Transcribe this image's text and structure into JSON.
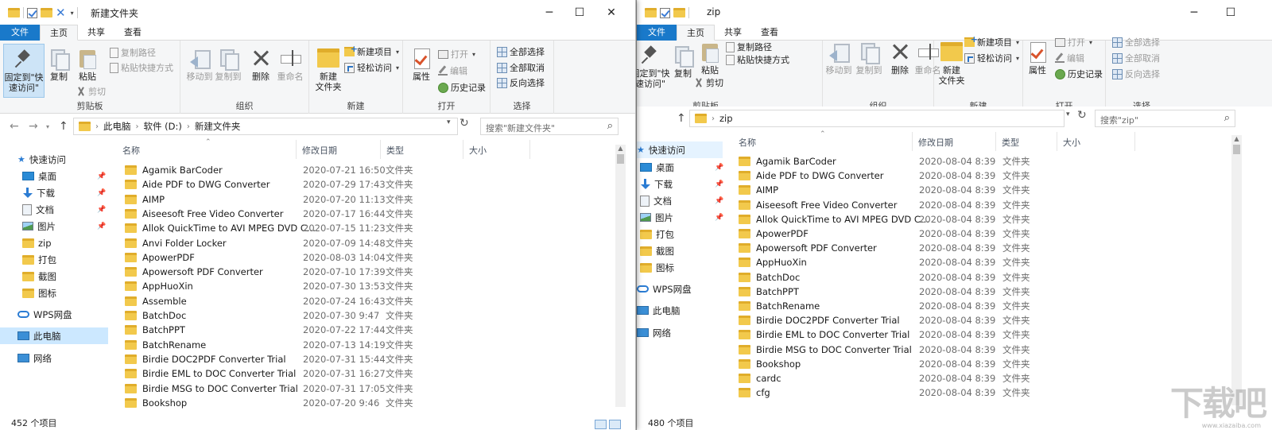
{
  "left": {
    "title": "新建文件夹",
    "tabs": [
      "文件",
      "主页",
      "共享",
      "查看"
    ],
    "ribbon": {
      "clipboard": {
        "pin_label": "固定到\"快速访问\"",
        "copy": "复制",
        "paste": "粘贴",
        "copy_path": "复制路径",
        "paste_shortcut": "粘贴快捷方式",
        "cut": "剪切",
        "group": "剪贴板"
      },
      "organize": {
        "move_to": "移动到",
        "copy_to": "复制到",
        "delete": "删除",
        "rename": "重命名",
        "group": "组织"
      },
      "new": {
        "new_folder": "新建\n文件夹",
        "new_item": "新建项目",
        "easy_access": "轻松访问",
        "group": "新建"
      },
      "open": {
        "properties": "属性",
        "open": "打开",
        "edit": "编辑",
        "history": "历史记录",
        "group": "打开"
      },
      "select": {
        "select_all": "全部选择",
        "select_none": "全部取消",
        "invert": "反向选择",
        "group": "选择"
      }
    },
    "address": {
      "pc": "此电脑",
      "drive": "软件 (D:)",
      "folder": "新建文件夹"
    },
    "search_placeholder": "搜索\"新建文件夹\"",
    "nav": {
      "quick_access": "快速访问",
      "items": [
        "桌面",
        "下载",
        "文档",
        "图片",
        "zip",
        "打包",
        "截图",
        "图标"
      ],
      "wps": "WPS网盘",
      "pc": "此电脑",
      "network": "网络"
    },
    "columns": {
      "name": "名称",
      "date": "修改日期",
      "type": "类型",
      "size": "大小"
    },
    "files": [
      {
        "name": "Agamik BarCoder",
        "date": "2020-07-21 16:50",
        "type": "文件夹"
      },
      {
        "name": "Aide PDF to DWG Converter",
        "date": "2020-07-29 17:43",
        "type": "文件夹"
      },
      {
        "name": "AIMP",
        "date": "2020-07-20 11:13",
        "type": "文件夹"
      },
      {
        "name": "Aiseesoft Free Video Converter",
        "date": "2020-07-17 16:44",
        "type": "文件夹"
      },
      {
        "name": "Allok QuickTime to AVI MPEG DVD C...",
        "date": "2020-07-15 11:23",
        "type": "文件夹"
      },
      {
        "name": "Anvi Folder Locker",
        "date": "2020-07-09 14:48",
        "type": "文件夹"
      },
      {
        "name": "ApowerPDF",
        "date": "2020-08-03 14:04",
        "type": "文件夹"
      },
      {
        "name": "Apowersoft PDF Converter",
        "date": "2020-07-10 17:39",
        "type": "文件夹"
      },
      {
        "name": "AppHuoXin",
        "date": "2020-07-30 13:53",
        "type": "文件夹"
      },
      {
        "name": "Assemble",
        "date": "2020-07-24 16:43",
        "type": "文件夹"
      },
      {
        "name": "BatchDoc",
        "date": "2020-07-30 9:47",
        "type": "文件夹"
      },
      {
        "name": "BatchPPT",
        "date": "2020-07-22 17:44",
        "type": "文件夹"
      },
      {
        "name": "BatchRename",
        "date": "2020-07-13 14:19",
        "type": "文件夹"
      },
      {
        "name": "Birdie DOC2PDF Converter Trial",
        "date": "2020-07-31 15:44",
        "type": "文件夹"
      },
      {
        "name": "Birdie EML to DOC Converter Trial",
        "date": "2020-07-31 16:27",
        "type": "文件夹"
      },
      {
        "name": "Birdie MSG to DOC Converter Trial",
        "date": "2020-07-31 17:05",
        "type": "文件夹"
      },
      {
        "name": "Bookshop",
        "date": "2020-07-20 9:46",
        "type": "文件夹"
      }
    ],
    "status": "452 个项目"
  },
  "right": {
    "title": "zip",
    "tabs": [
      "文件",
      "主页",
      "共享",
      "查看"
    ],
    "ribbon": {
      "clipboard": {
        "pin_label": "固定到\"快速访问\"",
        "copy": "复制",
        "paste": "粘贴",
        "copy_path": "复制路径",
        "paste_shortcut": "粘贴快捷方式",
        "cut": "剪切",
        "group": "剪贴板"
      },
      "organize": {
        "move_to": "移动到",
        "copy_to": "复制到",
        "delete": "删除",
        "rename": "重命名",
        "group": "组织"
      },
      "new": {
        "new_folder": "新建\n文件夹",
        "new_item": "新建项目",
        "easy_access": "轻松访问",
        "group": "新建"
      },
      "open": {
        "properties": "属性",
        "open": "打开",
        "edit": "编辑",
        "history": "历史记录",
        "group": "打开"
      },
      "select": {
        "select_all": "全部选择",
        "select_none": "全部取消",
        "invert": "反向选择",
        "group": "选择"
      }
    },
    "address": {
      "folder": "zip"
    },
    "search_placeholder": "搜索\"zip\"",
    "nav": {
      "quick_access": "快速访问",
      "items": [
        "桌面",
        "下载",
        "文档",
        "图片",
        "打包",
        "截图",
        "图标"
      ],
      "wps": "WPS网盘",
      "pc": "此电脑",
      "network": "网络"
    },
    "columns": {
      "name": "名称",
      "date": "修改日期",
      "type": "类型",
      "size": "大小"
    },
    "files": [
      {
        "name": "Agamik BarCoder",
        "date": "2020-08-04 8:39",
        "type": "文件夹"
      },
      {
        "name": "Aide PDF to DWG Converter",
        "date": "2020-08-04 8:39",
        "type": "文件夹"
      },
      {
        "name": "AIMP",
        "date": "2020-08-04 8:39",
        "type": "文件夹"
      },
      {
        "name": "Aiseesoft Free Video Converter",
        "date": "2020-08-04 8:39",
        "type": "文件夹"
      },
      {
        "name": "Allok QuickTime to AVI MPEG DVD C...",
        "date": "2020-08-04 8:39",
        "type": "文件夹"
      },
      {
        "name": "ApowerPDF",
        "date": "2020-08-04 8:39",
        "type": "文件夹"
      },
      {
        "name": "Apowersoft PDF Converter",
        "date": "2020-08-04 8:39",
        "type": "文件夹"
      },
      {
        "name": "AppHuoXin",
        "date": "2020-08-04 8:39",
        "type": "文件夹"
      },
      {
        "name": "BatchDoc",
        "date": "2020-08-04 8:39",
        "type": "文件夹"
      },
      {
        "name": "BatchPPT",
        "date": "2020-08-04 8:39",
        "type": "文件夹"
      },
      {
        "name": "BatchRename",
        "date": "2020-08-04 8:39",
        "type": "文件夹"
      },
      {
        "name": "Birdie DOC2PDF Converter Trial",
        "date": "2020-08-04 8:39",
        "type": "文件夹"
      },
      {
        "name": "Birdie EML to DOC Converter Trial",
        "date": "2020-08-04 8:39",
        "type": "文件夹"
      },
      {
        "name": "Birdie MSG to DOC Converter Trial",
        "date": "2020-08-04 8:39",
        "type": "文件夹"
      },
      {
        "name": "Bookshop",
        "date": "2020-08-04 8:39",
        "type": "文件夹"
      },
      {
        "name": "cardc",
        "date": "2020-08-04 8:39",
        "type": "文件夹"
      },
      {
        "name": "cfg",
        "date": "2020-08-04 8:39",
        "type": "文件夹"
      }
    ],
    "status": "480 个项目"
  },
  "watermark": "下载吧",
  "watermark_sub": "www.xiazaiba.com",
  "colors": {
    "file_tab": "#1979ca",
    "selection": "#cce8ff",
    "folder": "#f2c94c"
  }
}
